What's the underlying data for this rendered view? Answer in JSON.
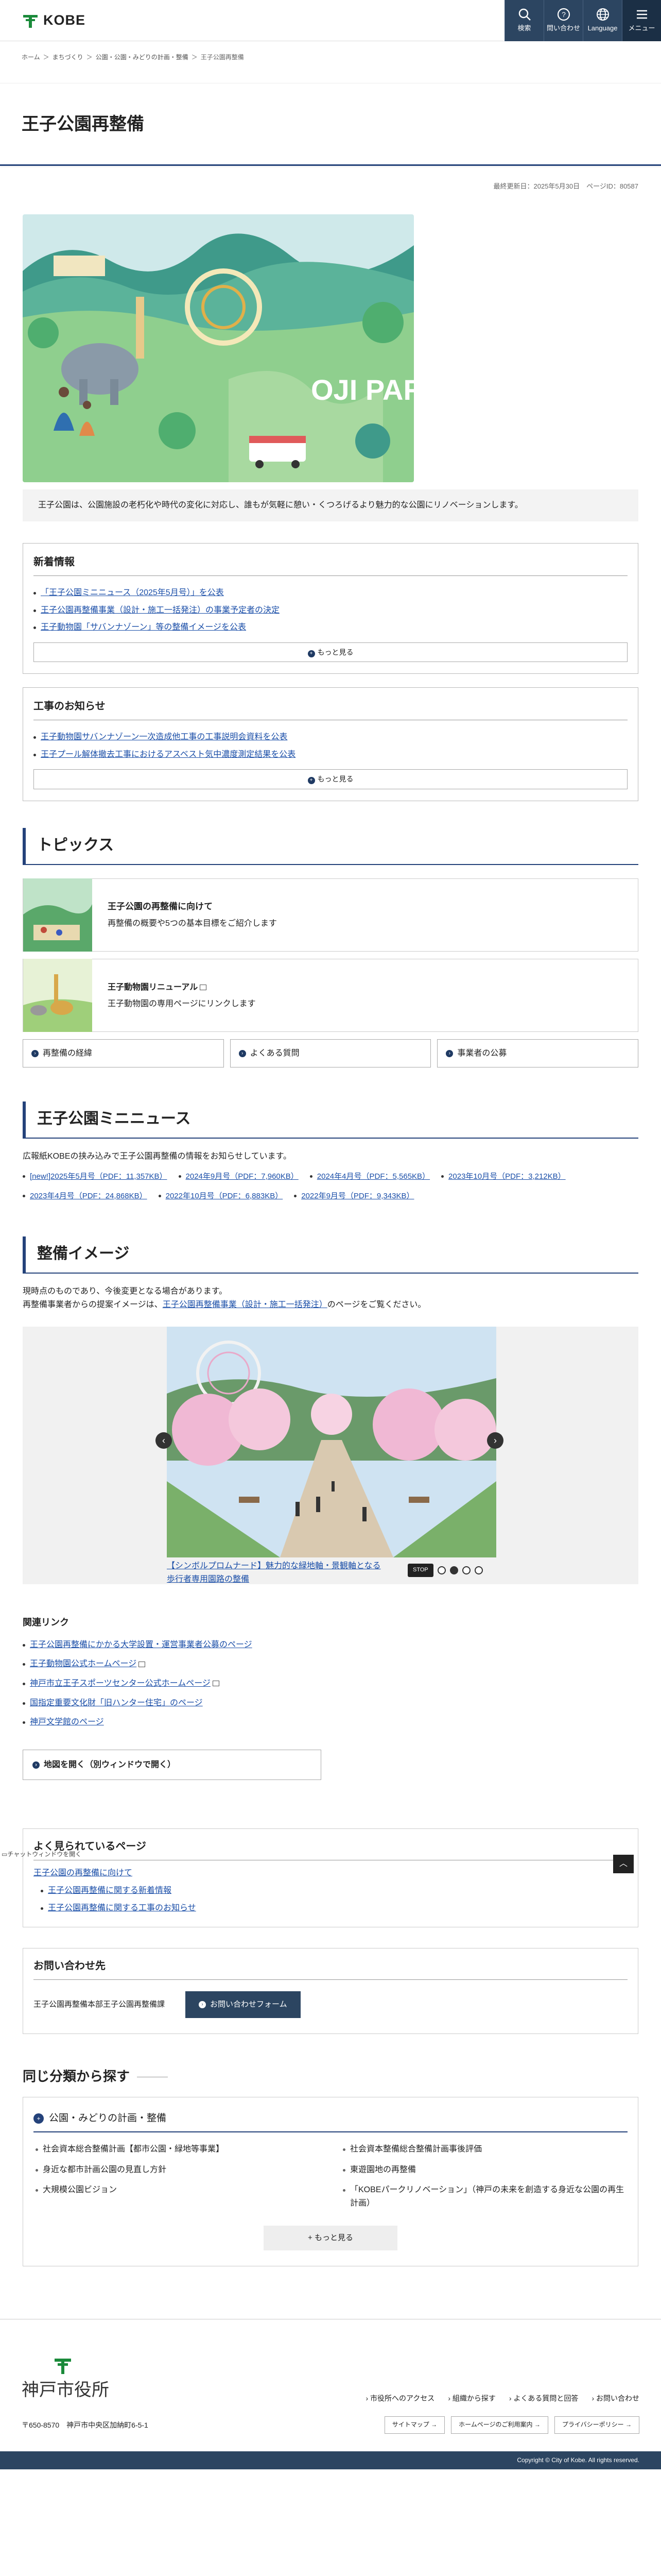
{
  "header": {
    "logo_text": "KOBE",
    "buttons": [
      {
        "label": "検索",
        "icon": "search-icon"
      },
      {
        "label": "問い合わせ",
        "icon": "question-icon"
      },
      {
        "label": "Language",
        "icon": "globe-icon"
      },
      {
        "label": "メニュー",
        "icon": "menu-icon"
      }
    ]
  },
  "breadcrumb": [
    "ホーム",
    "まちづくり",
    "公園・公園・みどりの計画・整備",
    "王子公園再整備"
  ],
  "page": {
    "title": "王子公園再整備",
    "meta": "最終更新日：2025年5月30日　ページID：80587",
    "intro": "王子公園は、公園施設の老朽化や時代の変化に対応し、誰もが気軽に憩い・くつろげるより魅力的な公園にリノベーションします。"
  },
  "news": {
    "title": "新着情報",
    "items": [
      "「王子公園ミニニュース（2025年5月号）」を公表",
      "王子公園再整備事業（設計・施工一括発注）の事業予定者の決定",
      "王子動物園「サバンナゾーン」等の整備イメージを公表"
    ],
    "more": "もっと見る"
  },
  "construction": {
    "title": "工事のお知らせ",
    "items": [
      "王子動物園サバンナゾーン一次造成他工事の工事説明会資料を公表",
      "王子プール解体撤去工事におけるアスベスト気中濃度測定結果を公表"
    ],
    "more": "もっと見る"
  },
  "topics": {
    "heading": "トピックス",
    "cards": [
      {
        "title": "王子公園の再整備に向けて",
        "desc": "再整備の概要や5つの基本目標をご紹介します"
      },
      {
        "title": "王子動物園リニューアル",
        "desc": "王子動物園の専用ページにリンクします"
      }
    ],
    "buttons": [
      "再整備の経緯",
      "よくある質問",
      "事業者の公募"
    ]
  },
  "mini_news": {
    "heading": "王子公園ミニニュース",
    "text": "広報紙KOBEの挟み込みで王子公園再整備の情報をお知らせしています。",
    "links": [
      "[new!]2025年5月号（PDF：11,357KB）",
      "2024年9月号（PDF：7,960KB）",
      "2024年4月号（PDF：5,565KB）",
      "2023年10月号（PDF：3,212KB）",
      "2023年4月号（PDF：24,868KB）",
      "2022年10月号（PDF：6,883KB）",
      "2022年9月号（PDF：9,343KB）"
    ]
  },
  "images": {
    "heading": "整備イメージ",
    "text1": "現時点のものであり、今後変更となる場合があります。",
    "text2_pre": "再整備事業者からの提案イメージは、",
    "text2_link": "王子公園再整備事業（設計・施工一括発注）",
    "text2_post": "のページをご覧ください。",
    "caption": "【シンボルプロムナード】魅力的な緑地軸・景観軸となる歩行者専用園路の整備",
    "stop": "STOP",
    "slide_count": 4,
    "active_slide": 2
  },
  "related": {
    "title": "関連リンク",
    "links": [
      "王子公園再整備にかかる大学設置・運営事業者公募のページ",
      "王子動物園公式ホームページ",
      "神戸市立王子スポーツセンター公式ホームページ",
      "国指定重要文化財「旧ハンター住宅」のページ",
      "神戸文学館のページ"
    ],
    "map_button": "地図を開く（別ウィンドウで開く）"
  },
  "popular": {
    "title": "よく見られているページ",
    "chat_label": "チャットウィンドウを開く",
    "items": [
      {
        "text": "王子公園の再整備に向けて",
        "sub": false
      },
      {
        "text": "王子公園再整備に関する新着情報",
        "sub": true
      },
      {
        "text": "王子公園再整備に関する工事のお知らせ",
        "sub": true
      }
    ]
  },
  "inquiry": {
    "title": "お問い合わせ先",
    "dept": "王子公園再整備本部王子公園再整備課",
    "button": "お問い合わせフォーム"
  },
  "same_category": {
    "title": "同じ分類から探す",
    "category": "公園・みどりの計画・整備",
    "items": [
      "社会資本総合整備計画【都市公園・緑地等事業】",
      "社会資本整備総合整備計画事後評価",
      "身近な都市計画公園の見直し方針",
      "東遊園地の再整備",
      "大規模公園ビジョン",
      "「KOBEパークリノベーション」（神戸の未来を創造する身近な公園の再生計画）"
    ],
    "more": "もっと見る"
  },
  "footer": {
    "logo": "神戸市役所",
    "address": "〒650-8570　神戸市中央区加納町6-5-1",
    "links": [
      "市役所へのアクセス",
      "組織から探す",
      "よくある質問と回答",
      "お問い合わせ"
    ],
    "buttons": [
      "サイトマップ",
      "ホームページのご利用案内",
      "プライバシーポリシー"
    ],
    "copyright": "Copyright © City of Kobe. All rights reserved."
  },
  "colors": {
    "primary": "#24427a",
    "header_button": "#2c4561"
  }
}
